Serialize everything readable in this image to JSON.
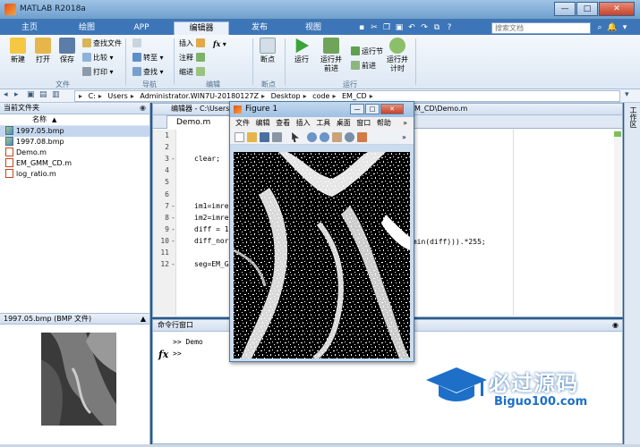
{
  "window": {
    "title": "MATLAB R2018a",
    "buttons": {
      "minimize": "—",
      "maximize": "□",
      "close": "✕"
    }
  },
  "ribbon_tabs": [
    {
      "label": "主页",
      "active": false
    },
    {
      "label": "绘图",
      "active": false
    },
    {
      "label": "APP",
      "active": false
    },
    {
      "label": "编辑器",
      "active": true
    },
    {
      "label": "发布",
      "active": false
    },
    {
      "label": "视图",
      "active": false
    }
  ],
  "search": {
    "placeholder": "搜索文档"
  },
  "ribbon": {
    "file": {
      "label": "文件",
      "new": "新建",
      "open": "打开",
      "save": "保存",
      "find_files": "查找文件",
      "compare": "比较",
      "print": "打印"
    },
    "navigate": {
      "label": "导航",
      "goto": "转至",
      "find": "查找"
    },
    "edit": {
      "label": "编辑",
      "insert": "插入",
      "comment": "注释",
      "indent": "缩进",
      "fx": "fx"
    },
    "breakpoints": {
      "label": "断点",
      "breakpoint": "断点"
    },
    "run": {
      "label": "运行",
      "run": "运行",
      "run_advance": "运行并\n前进",
      "run_section": "运行节",
      "advance": "前进",
      "run_time": "运行并\n计时"
    }
  },
  "address": {
    "crumbs": [
      "C:",
      "Users",
      "Administrator.WIN7U-20180127Z",
      "Desktop",
      "code",
      "EM_CD"
    ]
  },
  "current_folder": {
    "title": "当前文件夹",
    "column": "名称",
    "column_sort": "▲",
    "files": [
      {
        "name": "1997.05.bmp",
        "type": "bmp",
        "selected": true
      },
      {
        "name": "1997.08.bmp",
        "type": "bmp",
        "selected": false
      },
      {
        "name": "Demo.m",
        "type": "m",
        "selected": false
      },
      {
        "name": "EM_GMM_CD.m",
        "type": "m",
        "selected": false
      },
      {
        "name": "log_ratio.m",
        "type": "m",
        "selected": false
      }
    ]
  },
  "details": {
    "title": "1997.05.bmp  (BMP 文件)"
  },
  "editor": {
    "header": "编辑器 - C:\\Users",
    "header_tail": "M_CD\\Demo.m",
    "tab": "Demo.m",
    "lines": [
      {
        "num": "1",
        "dash": "",
        "code": ""
      },
      {
        "num": "2",
        "dash": "",
        "code": ""
      },
      {
        "num": "3",
        "dash": "-",
        "code": "clear;"
      },
      {
        "num": "4",
        "dash": "",
        "code": ""
      },
      {
        "num": "5",
        "dash": "",
        "code": ""
      },
      {
        "num": "6",
        "dash": "",
        "code": ""
      },
      {
        "num": "7",
        "dash": "-",
        "code": "im1=imre"
      },
      {
        "num": "8",
        "dash": "-",
        "code": "im2=imre"
      },
      {
        "num": "9",
        "dash": "-",
        "code": "diff = 1"
      },
      {
        "num": "10",
        "dash": "-",
        "code": "diff_nor"
      },
      {
        "num": "11",
        "dash": "",
        "code": ""
      },
      {
        "num": "12",
        "dash": "-",
        "code": "seg=EM_G"
      }
    ],
    "line10_tail": "(min(diff))).*255;"
  },
  "command_window": {
    "title": "命令行窗口",
    "history": ">> Demo",
    "prompt": ">>",
    "fx": "fx"
  },
  "workspace_strip": {
    "label": "工作区"
  },
  "figure": {
    "title": "Figure 1",
    "menu": [
      "文件",
      "编辑",
      "查看",
      "插入",
      "工具",
      "桌面",
      "窗口",
      "帮助"
    ]
  },
  "watermark": {
    "text": "必过源码",
    "subtext": "Biguo100.com"
  },
  "colors": {
    "tab_bar": "#3d76b8",
    "accent": "#1d6fc8"
  }
}
